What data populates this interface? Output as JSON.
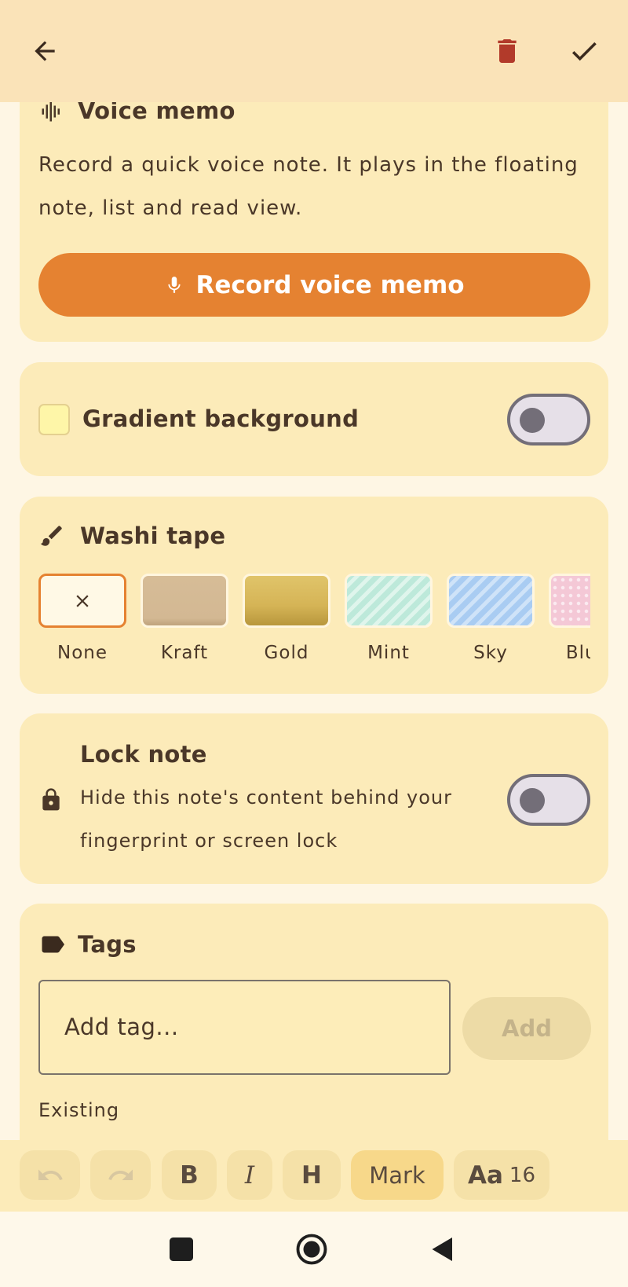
{
  "top_bar": {
    "back_icon": "arrow-left-icon",
    "delete_icon": "trash-icon",
    "save_icon": "check-icon",
    "delete_color": "#B23A2A"
  },
  "voice_memo": {
    "title": "Voice memo",
    "description_line1": "Record a quick voice note. It plays in the floating",
    "description_line2": "note, list and read view.",
    "button_label": "Record voice memo"
  },
  "gradient": {
    "label": "Gradient background",
    "enabled": false
  },
  "washi": {
    "title": "Washi tape",
    "options": [
      {
        "label": "None",
        "selected": true
      },
      {
        "label": "Kraft",
        "selected": false
      },
      {
        "label": "Gold",
        "selected": false
      },
      {
        "label": "Mint",
        "selected": false
      },
      {
        "label": "Sky",
        "selected": false
      },
      {
        "label": "Blush",
        "selected": false
      }
    ]
  },
  "lock": {
    "title": "Lock note",
    "description_line1": "Hide this note's content behind your",
    "description_line2": "fingerprint or screen lock",
    "enabled": false
  },
  "tags": {
    "title": "Tags",
    "input_placeholder": "Add tag...",
    "add_label": "Add",
    "existing_label": "Existing"
  },
  "toolbar": {
    "bold": "B",
    "italic": "I",
    "heading": "H",
    "mark": "Mark",
    "font_label": "Aa",
    "font_size": "16"
  },
  "colors": {
    "accent": "#E58231",
    "card": "#FCEBB9",
    "background": "#FEF6E4",
    "top_bar": "#FAE3B8"
  }
}
